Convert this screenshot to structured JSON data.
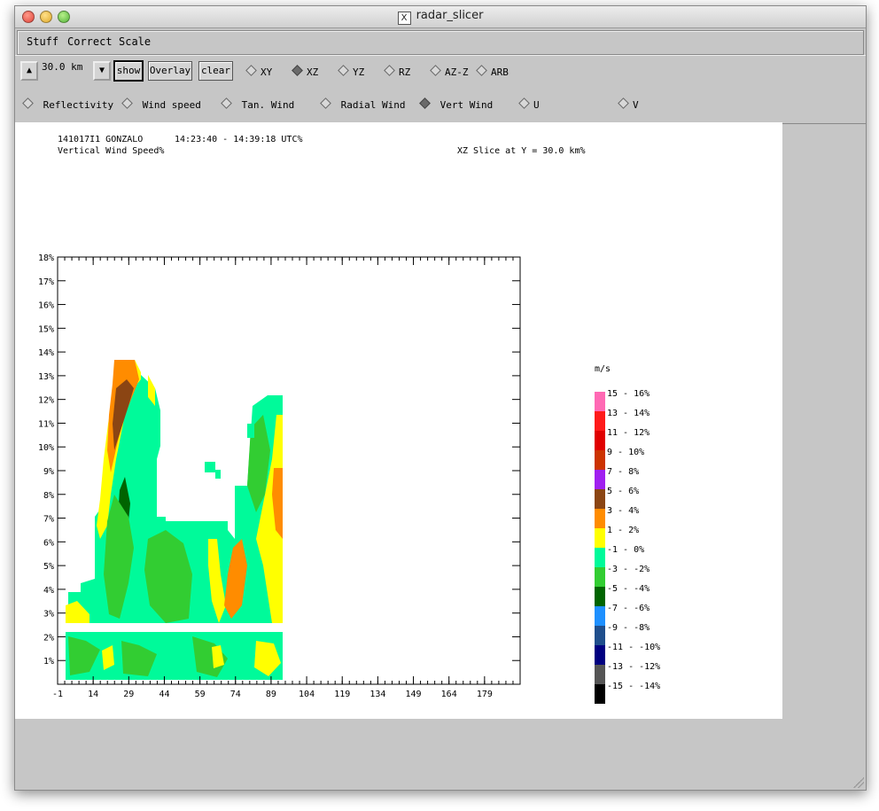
{
  "window": {
    "title": "radar_slicer"
  },
  "menus": [
    "Stuff",
    "Correct",
    "Scale"
  ],
  "toolbar": {
    "height_value": "30.0 km",
    "show_label": "show",
    "overlay_label": "Overlay",
    "clear_label": "clear",
    "slice_modes": [
      {
        "label": "XY",
        "selected": false
      },
      {
        "label": "XZ",
        "selected": true
      },
      {
        "label": "YZ",
        "selected": false
      },
      {
        "label": "RZ",
        "selected": false
      },
      {
        "label": "AZ-Z",
        "selected": false
      },
      {
        "label": "ARB",
        "selected": false
      }
    ],
    "fields": [
      {
        "label": "Reflectivity",
        "selected": false
      },
      {
        "label": "Wind speed",
        "selected": false
      },
      {
        "label": "Tan. Wind",
        "selected": false
      },
      {
        "label": "Radial Wind",
        "selected": false
      },
      {
        "label": "Vert Wind",
        "selected": true
      },
      {
        "label": "U",
        "selected": false
      },
      {
        "label": "V",
        "selected": false
      }
    ]
  },
  "plot": {
    "header_id": "141017I1 GONZALO",
    "header_time": "14:23:40 - 14:39:18 UTC%",
    "field_name": "Vertical Wind Speed%",
    "slice_info": "XZ Slice at Y = 30.0 km%",
    "legend_unit": "m/s"
  },
  "chart_data": {
    "type": "heatmap",
    "x_ticks": [
      "-1",
      "14",
      "29",
      "44",
      "59",
      "74",
      "89",
      "104",
      "119",
      "134",
      "149",
      "164",
      "179"
    ],
    "y_ticks": [
      "1%",
      "2%",
      "3%",
      "4%",
      "5%",
      "6%",
      "7%",
      "8%",
      "9%",
      "10%",
      "11%",
      "12%",
      "13%",
      "14%",
      "15%",
      "16%",
      "17%",
      "18%"
    ],
    "xlim": [
      -1,
      194
    ],
    "ylim": [
      0,
      18
    ],
    "legend": [
      {
        "label": "15 - 16%",
        "color": "#ff69b4"
      },
      {
        "label": "13 - 14%",
        "color": "#ff1a1a"
      },
      {
        "label": "11 - 12%",
        "color": "#e00000"
      },
      {
        "label": "9 - 10%",
        "color": "#cc3300"
      },
      {
        "label": "7 - 8%",
        "color": "#a020f0"
      },
      {
        "label": "5 - 6%",
        "color": "#8b4513"
      },
      {
        "label": "3 - 4%",
        "color": "#ff8c00"
      },
      {
        "label": "1 - 2%",
        "color": "#ffff00"
      },
      {
        "label": "-1 - 0%",
        "color": "#00fa9a"
      },
      {
        "label": "-3 - -2%",
        "color": "#32cd32"
      },
      {
        "label": "-5 - -4%",
        "color": "#006400"
      },
      {
        "label": "-7 - -6%",
        "color": "#1e90ff"
      },
      {
        "label": "-9 - -8%",
        "color": "#1f4e8c"
      },
      {
        "label": "-11 - -10%",
        "color": "#000080"
      },
      {
        "label": "-13 - -12%",
        "color": "#555555"
      },
      {
        "label": "-15 - -14%",
        "color": "#000000"
      }
    ]
  }
}
